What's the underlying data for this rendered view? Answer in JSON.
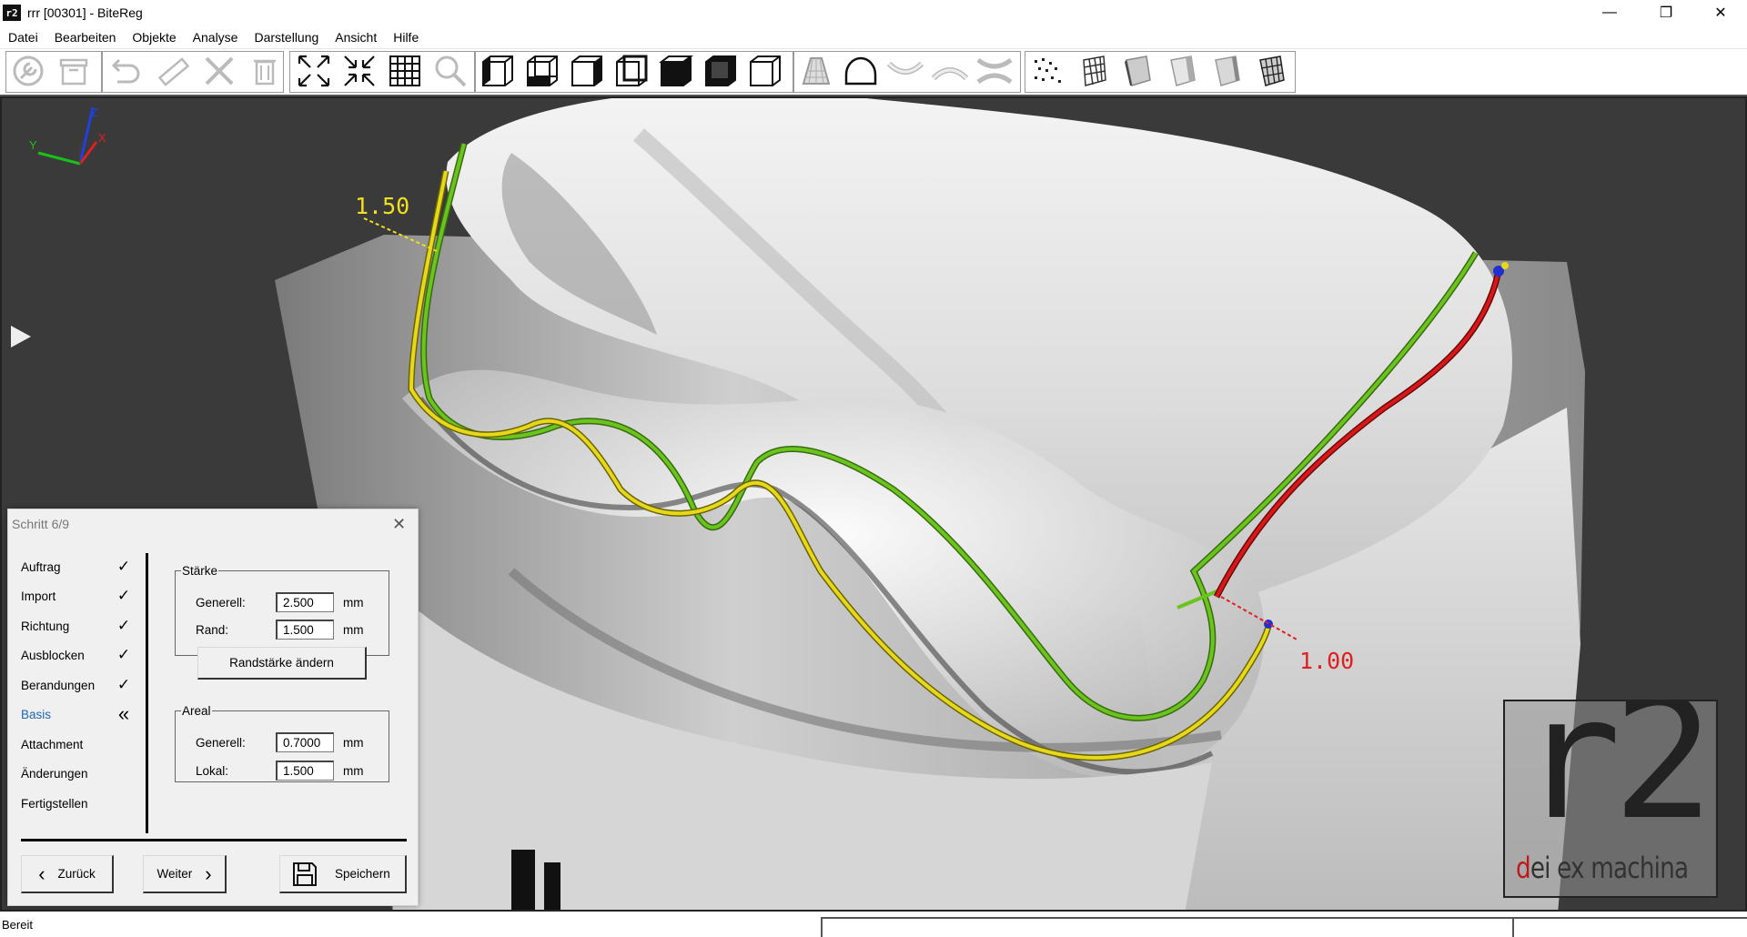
{
  "window": {
    "app_icon": "r2",
    "title": "rrr [00301] - BiteReg",
    "controls": [
      "minimize-icon",
      "restore-icon",
      "close-icon"
    ],
    "minimize_glyph": "—",
    "restore_glyph": "❐",
    "close_glyph": "✕"
  },
  "menu": {
    "items": [
      "Datei",
      "Bearbeiten",
      "Objekte",
      "Analyse",
      "Darstellung",
      "Ansicht",
      "Hilfe"
    ]
  },
  "toolbar": {
    "groups": [
      [
        "wrench-icon",
        "box-icon",
        "undo-icon"
      ],
      [
        "ruler-icon",
        "tools-icon",
        "trash-icon"
      ],
      [
        "expand-icon",
        "collapse-icon",
        "grid-icon",
        "zoom-icon"
      ],
      [
        "view-left-icon",
        "view-front-icon",
        "view-right-icon",
        "view-back-icon",
        "view-top-icon",
        "view-bottom-icon",
        "view-iso-icon"
      ],
      [
        "cone-icon",
        "dome-icon",
        "upper-jaw-icon",
        "lower-jaw-icon",
        "both-jaws-icon"
      ],
      [
        "points-icon",
        "mesh-icon",
        "solid-light-icon",
        "solid-shaded-icon",
        "solid-smooth-icon",
        "solid-wire-icon"
      ]
    ]
  },
  "viewport": {
    "axes": {
      "x": "X",
      "y": "Y",
      "z": "Z"
    },
    "colors": {
      "x": "#e02020",
      "y": "#18c018",
      "z": "#2040e0"
    },
    "play_glyph": "▶",
    "measurements": [
      {
        "value": "1.50",
        "color": "#f0e020"
      },
      {
        "value": "1.00",
        "color": "#e02020"
      }
    ],
    "curve_colors": {
      "green": "#6ac41e",
      "yellow": "#e8d81a",
      "red": "#d81818",
      "handle": "#2030d0"
    }
  },
  "logo": {
    "mark": "r2",
    "tagline_first": "d",
    "tagline_rest": "ei ex machina",
    "tagline_first_color": "#c01818"
  },
  "wizard": {
    "title": "Schritt 6/9",
    "close_glyph": "✕",
    "steps": [
      {
        "label": "Auftrag",
        "mark": "✓",
        "state": "done"
      },
      {
        "label": "Import",
        "mark": "✓",
        "state": "done"
      },
      {
        "label": "Richtung",
        "mark": "✓",
        "state": "done"
      },
      {
        "label": "Ausblocken",
        "mark": "✓",
        "state": "done"
      },
      {
        "label": "Berandungen",
        "mark": "✓",
        "state": "done"
      },
      {
        "label": "Basis",
        "mark": "«",
        "state": "active"
      },
      {
        "label": "Attachment",
        "mark": "",
        "state": "pending"
      },
      {
        "label": "Änderungen",
        "mark": "",
        "state": "pending"
      },
      {
        "label": "Fertigstellen",
        "mark": "",
        "state": "pending"
      }
    ],
    "staerke": {
      "legend": "Stärke",
      "generell_label": "Generell:",
      "generell_value": "2.500",
      "rand_label": "Rand:",
      "rand_value": "1.500",
      "unit": "mm",
      "button": "Randstärke ändern"
    },
    "areal": {
      "legend": "Areal",
      "generell_label": "Generell:",
      "generell_value": "0.7000",
      "lokal_label": "Lokal:",
      "lokal_value": "1.500",
      "unit": "mm"
    },
    "buttons": {
      "back": "Zurück",
      "next": "Weiter",
      "save": "Speichern",
      "back_glyph": "‹",
      "next_glyph": "›"
    }
  },
  "statusbar": {
    "text": "Bereit"
  }
}
